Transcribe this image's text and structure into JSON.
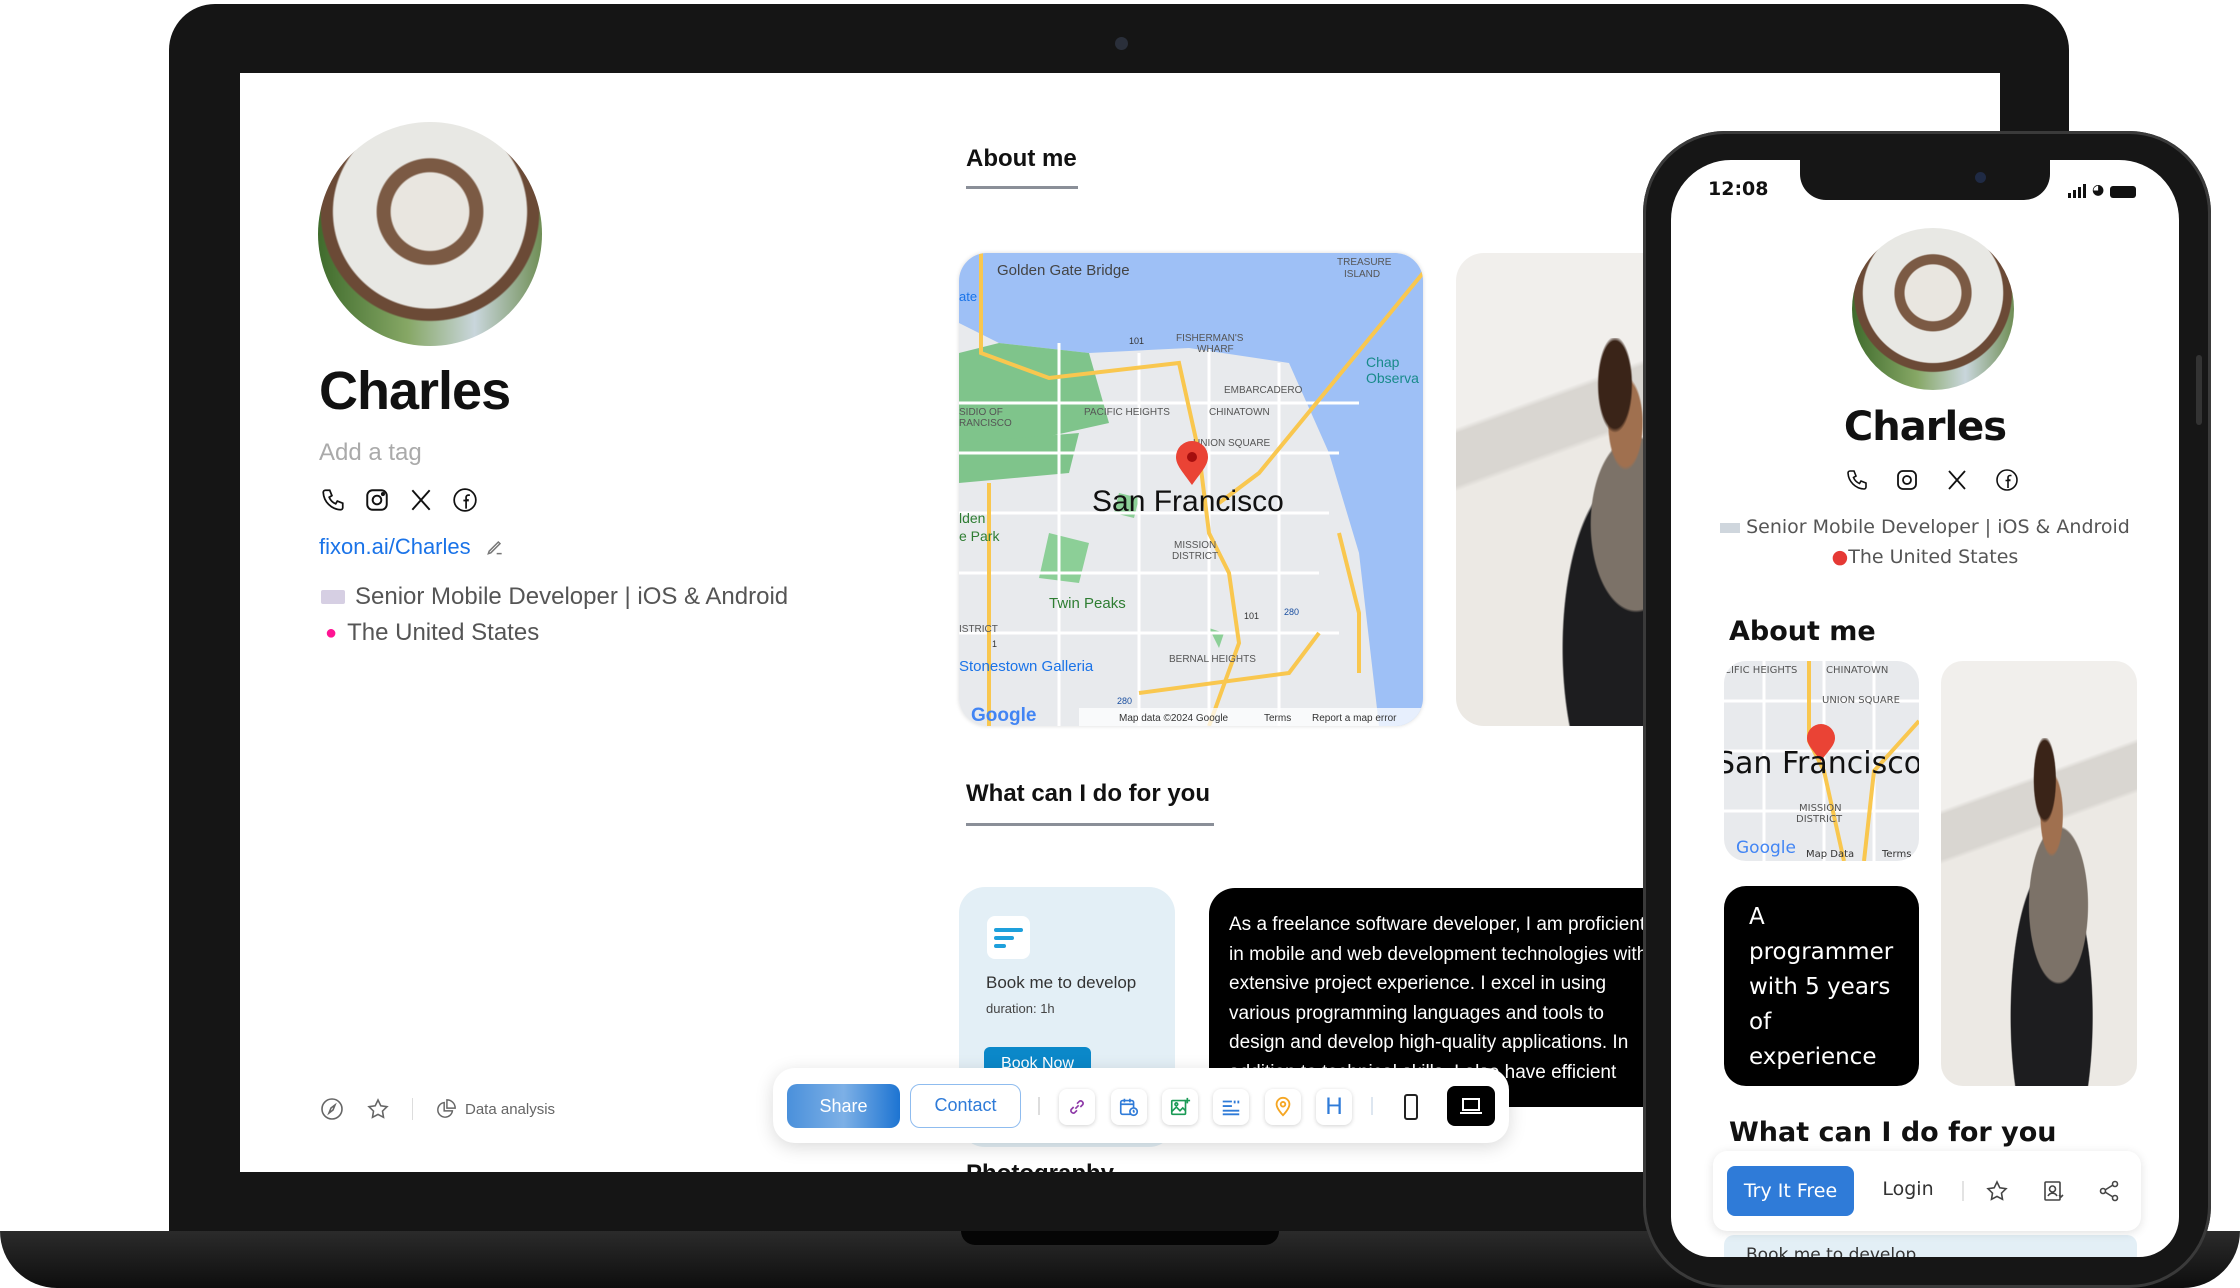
{
  "profile": {
    "name": "Charles",
    "tag_placeholder": "Add a tag",
    "link": "fixon.ai/Charles",
    "headline": "Senior Mobile Developer | iOS & Android",
    "location": "The United States",
    "social_icons": [
      "phone-icon",
      "instagram-icon",
      "x-icon",
      "facebook-icon"
    ]
  },
  "sections": {
    "about": "About me",
    "services": "What can I do for you",
    "photography": "Photography"
  },
  "map": {
    "city": "San Francisco",
    "labels": {
      "ggb": "Golden Gate Bridge",
      "treasure1": "TREASURE",
      "treasure2": "ISLAND",
      "fw1": "FISHERMAN'S",
      "fw2": "WHARF",
      "embarcadero": "EMBARCADERO",
      "pacific": "PACIFIC HEIGHTS",
      "chinatown": "CHINATOWN",
      "union": "UNION SQUARE",
      "mission1": "MISSION",
      "mission2": "DISTRICT",
      "twin": "Twin Peaks",
      "bernal": "BERNAL HEIGHTS",
      "stonestown": "Stonestown Galleria",
      "presidio1": "SIDIO OF",
      "presidio2": "RANCISCO",
      "golden1": "lden",
      "golden2": "e Park",
      "district": "ISTRICT",
      "chap1": "Chap",
      "chap2": "Observa",
      "ate": "ate",
      "r101": "101",
      "r280": "280",
      "r1": "1"
    },
    "footer": {
      "data": "Map data ©2024 Google",
      "terms": "Terms",
      "report": "Report a map error"
    },
    "logo": "Google"
  },
  "service_card": {
    "title": "Book me to develop",
    "duration": "duration: 1h",
    "button": "Book Now"
  },
  "bio": "As a freelance software developer, I am proficient in mobile and web development technologies with extensive project experience. I excel in using various programming languages and tools to design and develop high-quality applications. In addition to technical skills, I also have efficient",
  "footer_left": {
    "data_analysis": "Data analysis"
  },
  "toolbar": {
    "share": "Share",
    "contact": "Contact",
    "tools": [
      "link-icon",
      "calendar-clock-icon",
      "image-add-icon",
      "text-quote-icon",
      "location-pin-icon",
      "heading-icon"
    ],
    "heading_glyph": "H",
    "view_modes": [
      "mobile-icon",
      "laptop-icon"
    ],
    "active_view": "laptop"
  },
  "phone": {
    "time": "12:08",
    "map_labels": {
      "pacific": "CIFIC HEIGHTS",
      "chinatown": "CHINATOWN",
      "union": "UNION SQUARE",
      "city": "San Francisco",
      "mission1": "MISSION",
      "mission2": "DISTRICT",
      "data": "Map Data",
      "terms": "Terms",
      "logo": "Google"
    },
    "tagline": "A programmer with 5 years of experience",
    "bottom_bar": {
      "try": "Try It Free",
      "login": "Login"
    },
    "peek": "Book me to develop"
  },
  "colors": {
    "link": "#1a73e8",
    "accent": "#2f7bd8",
    "book_card": "#e3eff6",
    "book_button": "#0b88c9",
    "pin": "#e53935"
  }
}
